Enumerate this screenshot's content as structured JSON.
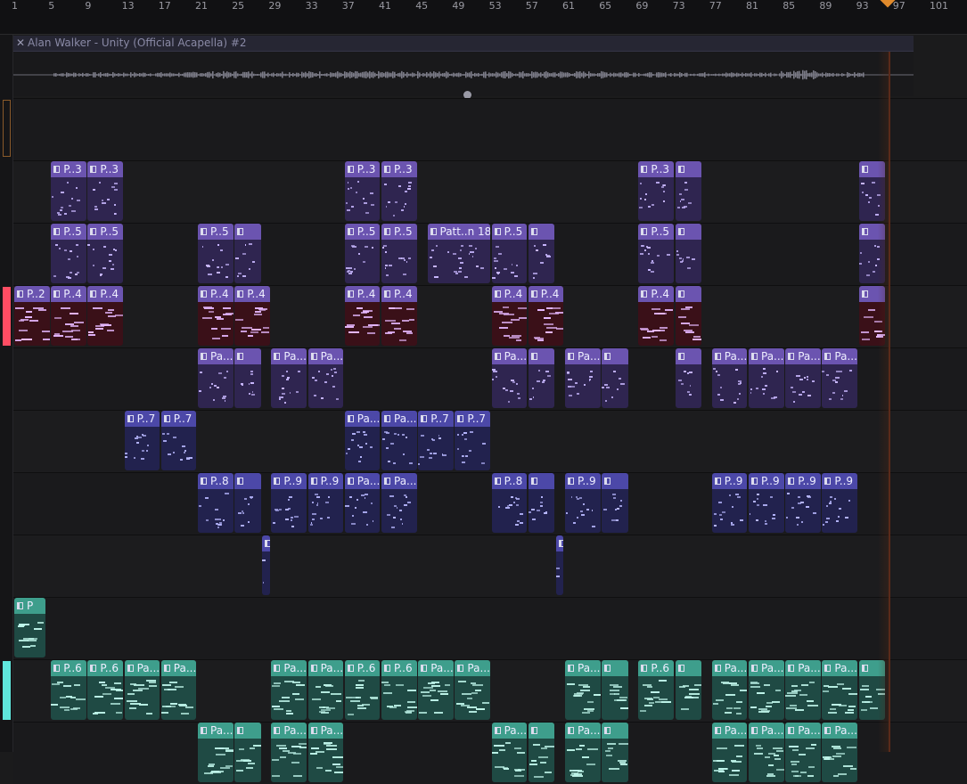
{
  "ruler": {
    "ticks": [
      "1",
      "5",
      "9",
      "13",
      "17",
      "21",
      "25",
      "29",
      "33",
      "37",
      "41",
      "45",
      "49",
      "53",
      "57",
      "61",
      "65",
      "69",
      "73",
      "77",
      "81",
      "85",
      "89",
      "93",
      "97",
      "101"
    ]
  },
  "audio_clip": {
    "title": "Alan Walker - Unity (Official Acapella) #2",
    "close_glyph": "✕"
  },
  "palette": {
    "purple_header": "#6b54b0",
    "purple_body": "#2f2550",
    "maroon_body": "#3a1018",
    "indigo_header": "#4c48a8",
    "indigo_body": "#22224e",
    "teal_header": "#3e9e8c",
    "teal_body": "#1f4a44",
    "accent_red": "#ff4d63",
    "accent_cyan": "#5fe6dc"
  },
  "tracks": [
    {
      "row": 1,
      "style": "purple",
      "clips": [
        {
          "label": "P..3",
          "start": 5,
          "len": 4
        },
        {
          "label": "P..3",
          "start": 9,
          "len": 4
        },
        {
          "label": "P..3",
          "start": 37,
          "len": 4
        },
        {
          "label": "P..3",
          "start": 41,
          "len": 4
        },
        {
          "label": "P..3",
          "start": 69,
          "len": 4
        },
        {
          "label": "",
          "start": 73,
          "len": 3
        },
        {
          "label": "",
          "start": 93,
          "len": 3
        }
      ]
    },
    {
      "row": 2,
      "style": "purple",
      "clips": [
        {
          "label": "P..5",
          "start": 5,
          "len": 4
        },
        {
          "label": "P..5",
          "start": 9,
          "len": 4
        },
        {
          "label": "P..5",
          "start": 21,
          "len": 4
        },
        {
          "label": "",
          "start": 25,
          "len": 3
        },
        {
          "label": "P..5",
          "start": 37,
          "len": 4
        },
        {
          "label": "P..5",
          "start": 41,
          "len": 4
        },
        {
          "label": "Patt..n 18",
          "start": 46,
          "len": 7
        },
        {
          "label": "P..5",
          "start": 53,
          "len": 4
        },
        {
          "label": "",
          "start": 57,
          "len": 3
        },
        {
          "label": "P..5",
          "start": 69,
          "len": 4
        },
        {
          "label": "",
          "start": 73,
          "len": 3
        },
        {
          "label": "",
          "start": 93,
          "len": 3
        }
      ]
    },
    {
      "row": 3,
      "style": "maroon",
      "clips": [
        {
          "label": "P..2",
          "start": 1,
          "len": 4
        },
        {
          "label": "P..4",
          "start": 5,
          "len": 4
        },
        {
          "label": "P..4",
          "start": 9,
          "len": 4
        },
        {
          "label": "P..4",
          "start": 21,
          "len": 4
        },
        {
          "label": "P..4",
          "start": 25,
          "len": 4
        },
        {
          "label": "P..4",
          "start": 37,
          "len": 4
        },
        {
          "label": "P..4",
          "start": 41,
          "len": 4
        },
        {
          "label": "P..4",
          "start": 53,
          "len": 4
        },
        {
          "label": "P..4",
          "start": 57,
          "len": 4
        },
        {
          "label": "P..4",
          "start": 69,
          "len": 4
        },
        {
          "label": "",
          "start": 73,
          "len": 3
        },
        {
          "label": "",
          "start": 93,
          "len": 3
        }
      ]
    },
    {
      "row": 4,
      "style": "purple",
      "clips": [
        {
          "label": "Pa...",
          "start": 21,
          "len": 4
        },
        {
          "label": "",
          "start": 25,
          "len": 3
        },
        {
          "label": "Pa...",
          "start": 29,
          "len": 4
        },
        {
          "label": "Pa...",
          "start": 33,
          "len": 4
        },
        {
          "label": "Pa...",
          "start": 53,
          "len": 4
        },
        {
          "label": "",
          "start": 57,
          "len": 3
        },
        {
          "label": "Pa...",
          "start": 61,
          "len": 4
        },
        {
          "label": "",
          "start": 65,
          "len": 3
        },
        {
          "label": "",
          "start": 73,
          "len": 3
        },
        {
          "label": "Pa...",
          "start": 77,
          "len": 4
        },
        {
          "label": "Pa...",
          "start": 81,
          "len": 4
        },
        {
          "label": "Pa...",
          "start": 85,
          "len": 4
        },
        {
          "label": "Pa...",
          "start": 89,
          "len": 4
        }
      ]
    },
    {
      "row": 5,
      "style": "indigo",
      "clips": [
        {
          "label": "P..7",
          "start": 13,
          "len": 4
        },
        {
          "label": "P..7",
          "start": 17,
          "len": 4
        },
        {
          "label": "Pa...",
          "start": 37,
          "len": 4
        },
        {
          "label": "Pa...",
          "start": 41,
          "len": 4
        },
        {
          "label": "P..7",
          "start": 45,
          "len": 4
        },
        {
          "label": "P..7",
          "start": 49,
          "len": 4
        }
      ]
    },
    {
      "row": 6,
      "style": "indigo",
      "clips": [
        {
          "label": "P..8",
          "start": 21,
          "len": 4
        },
        {
          "label": "",
          "start": 25,
          "len": 3
        },
        {
          "label": "P..9",
          "start": 29,
          "len": 4
        },
        {
          "label": "P..9",
          "start": 33,
          "len": 4
        },
        {
          "label": "Pa...",
          "start": 37,
          "len": 4
        },
        {
          "label": "Pa...",
          "start": 41,
          "len": 4
        },
        {
          "label": "P..8",
          "start": 53,
          "len": 4
        },
        {
          "label": "",
          "start": 57,
          "len": 3
        },
        {
          "label": "P..9",
          "start": 61,
          "len": 4
        },
        {
          "label": "",
          "start": 65,
          "len": 3
        },
        {
          "label": "P..9",
          "start": 77,
          "len": 4
        },
        {
          "label": "P..9",
          "start": 81,
          "len": 4
        },
        {
          "label": "P..9",
          "start": 85,
          "len": 4
        },
        {
          "label": "P..9",
          "start": 89,
          "len": 4
        }
      ]
    },
    {
      "row": 7,
      "style": "indigo",
      "clips": [
        {
          "label": "",
          "start": 28,
          "len": 1
        },
        {
          "label": "",
          "start": 60,
          "len": 1
        }
      ]
    },
    {
      "row": 8,
      "style": "teal",
      "clips": [
        {
          "label": "P",
          "start": 1,
          "len": 3.5
        }
      ]
    },
    {
      "row": 9,
      "style": "teal",
      "clips": [
        {
          "label": "P..6",
          "start": 5,
          "len": 4
        },
        {
          "label": "P..6",
          "start": 9,
          "len": 4
        },
        {
          "label": "Pa...",
          "start": 13,
          "len": 4
        },
        {
          "label": "Pa...",
          "start": 17,
          "len": 4
        },
        {
          "label": "Pa...",
          "start": 29,
          "len": 4
        },
        {
          "label": "Pa...",
          "start": 33,
          "len": 4
        },
        {
          "label": "P..6",
          "start": 37,
          "len": 4
        },
        {
          "label": "P..6",
          "start": 41,
          "len": 4
        },
        {
          "label": "Pa...",
          "start": 45,
          "len": 4
        },
        {
          "label": "Pa...",
          "start": 49,
          "len": 4
        },
        {
          "label": "Pa...",
          "start": 61,
          "len": 4
        },
        {
          "label": "",
          "start": 65,
          "len": 3
        },
        {
          "label": "P..6",
          "start": 69,
          "len": 4
        },
        {
          "label": "",
          "start": 73,
          "len": 3
        },
        {
          "label": "Pa...",
          "start": 77,
          "len": 4
        },
        {
          "label": "Pa...",
          "start": 81,
          "len": 4
        },
        {
          "label": "Pa...",
          "start": 85,
          "len": 4
        },
        {
          "label": "Pa...",
          "start": 89,
          "len": 4
        },
        {
          "label": "",
          "start": 93,
          "len": 3
        }
      ]
    },
    {
      "row": 10,
      "style": "teal",
      "clips": [
        {
          "label": "Pa...",
          "start": 21,
          "len": 4
        },
        {
          "label": "",
          "start": 25,
          "len": 3
        },
        {
          "label": "Pa...",
          "start": 29,
          "len": 4
        },
        {
          "label": "Pa...",
          "start": 33,
          "len": 4
        },
        {
          "label": "Pa...",
          "start": 53,
          "len": 4
        },
        {
          "label": "",
          "start": 57,
          "len": 3
        },
        {
          "label": "Pa...",
          "start": 61,
          "len": 4
        },
        {
          "label": "",
          "start": 65,
          "len": 3
        },
        {
          "label": "Pa...",
          "start": 77,
          "len": 4
        },
        {
          "label": "Pa...",
          "start": 81,
          "len": 4
        },
        {
          "label": "Pa...",
          "start": 85,
          "len": 4
        },
        {
          "label": "Pa...",
          "start": 89,
          "len": 4
        }
      ]
    }
  ],
  "track_colors": [
    {
      "row": 3,
      "color": "#ff4d63"
    },
    {
      "row": 9,
      "color": "#5fe6dc"
    }
  ]
}
